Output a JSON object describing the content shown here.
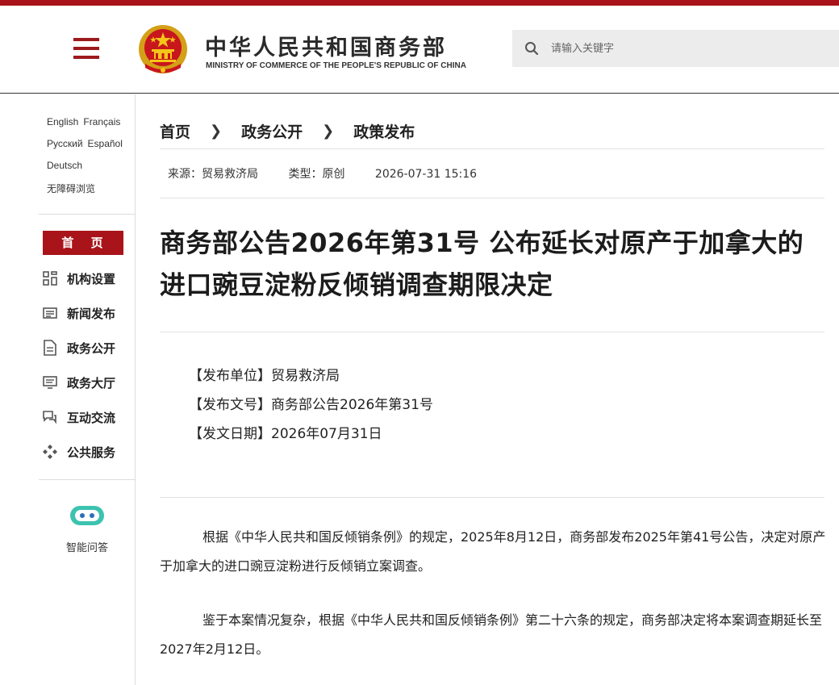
{
  "header": {
    "title_cn": "中华人民共和国商务部",
    "title_en": "MINISTRY OF COMMERCE OF THE PEOPLE'S REPUBLIC OF CHINA",
    "search_placeholder": "请输入关键字",
    "accent_color": "#a8141a"
  },
  "sidebar": {
    "languages": [
      "English",
      "Français",
      "Русский",
      "Español",
      "Deutsch"
    ],
    "accessibility": "无障碍浏览",
    "home_label": "首 页",
    "nav": [
      {
        "label": "机构设置",
        "icon": "org-grid-icon"
      },
      {
        "label": "新闻发布",
        "icon": "news-icon"
      },
      {
        "label": "政务公开",
        "icon": "document-icon"
      },
      {
        "label": "政务大厅",
        "icon": "service-hall-icon"
      },
      {
        "label": "互动交流",
        "icon": "chat-icon"
      },
      {
        "label": "公共服务",
        "icon": "public-service-icon"
      }
    ],
    "ai_label": "智能问答"
  },
  "breadcrumb": [
    "首页",
    "政务公开",
    "政策发布"
  ],
  "meta": {
    "source": "来源：贸易救济局",
    "type": "类型：原创",
    "datetime": "2026-07-31 15:16"
  },
  "article": {
    "title": "商务部公告2026年第31号 公布延长对原产于加拿大的进口豌豆淀粉反倾销调查期限决定",
    "info": [
      "【发布单位】贸易救济局",
      "【发布文号】商务部公告2026年第31号",
      "【发文日期】2026年07月31日"
    ],
    "paragraphs": [
      "根据《中华人民共和国反倾销条例》的规定，2025年8月12日，商务部发布2025年第41号公告，决定对原产于加拿大的进口豌豆淀粉进行反倾销立案调查。",
      "鉴于本案情况复杂，根据《中华人民共和国反倾销条例》第二十六条的规定，商务部决定将本案调查期延长至2027年2月12日。"
    ]
  }
}
